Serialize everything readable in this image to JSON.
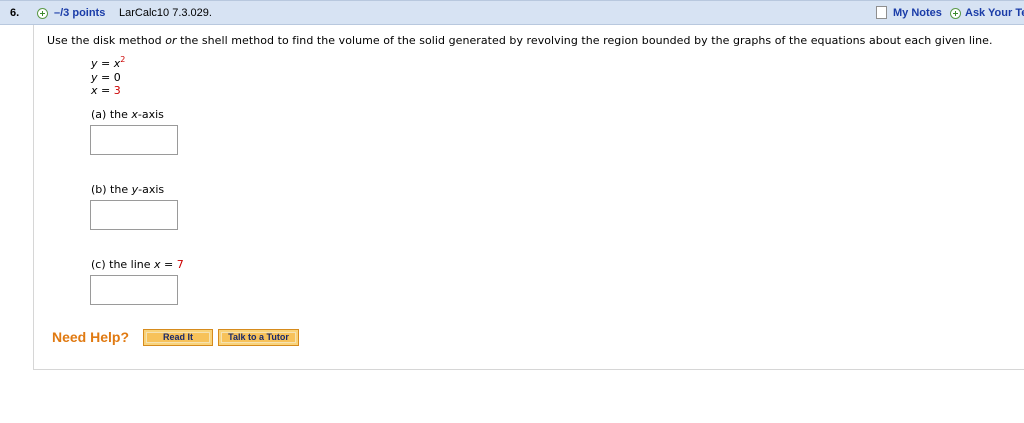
{
  "header": {
    "question_number": "6.",
    "points": "–/3 points",
    "source": "LarCalc10 7.3.029.",
    "my_notes": "My Notes",
    "ask_teacher": "Ask Your Te"
  },
  "question": {
    "prompt_pre": "Use the disk method ",
    "prompt_or": "or",
    "prompt_post": " the shell method to find the volume of the solid generated by revolving the region bounded by the graphs of the equations about each given line.",
    "equations": [
      {
        "var": "y",
        "rel": " = ",
        "rhs": "x",
        "sup": "2"
      },
      {
        "var": "y",
        "rel": " = ",
        "rhs": "0"
      },
      {
        "var": "x",
        "rel": " = ",
        "rhs": "3"
      }
    ],
    "parts": [
      {
        "prefix": "(a) the ",
        "var": "x",
        "suffix": "-axis",
        "answer": ""
      },
      {
        "prefix": "(b) the ",
        "var": "y",
        "suffix": "-axis",
        "answer": ""
      },
      {
        "prefix": "(c) the line ",
        "var": "x",
        "suffix": " = ",
        "value": "7",
        "answer": ""
      }
    ]
  },
  "help": {
    "label": "Need Help?",
    "read_it": "Read It",
    "talk_to_tutor": "Talk to a Tutor"
  },
  "colors": {
    "header_bg": "#d7e3f3",
    "link_blue": "#1a3ca8",
    "highlight_red": "#cc0000",
    "help_orange": "#e07a12",
    "button_fill": "#f7c25a"
  }
}
